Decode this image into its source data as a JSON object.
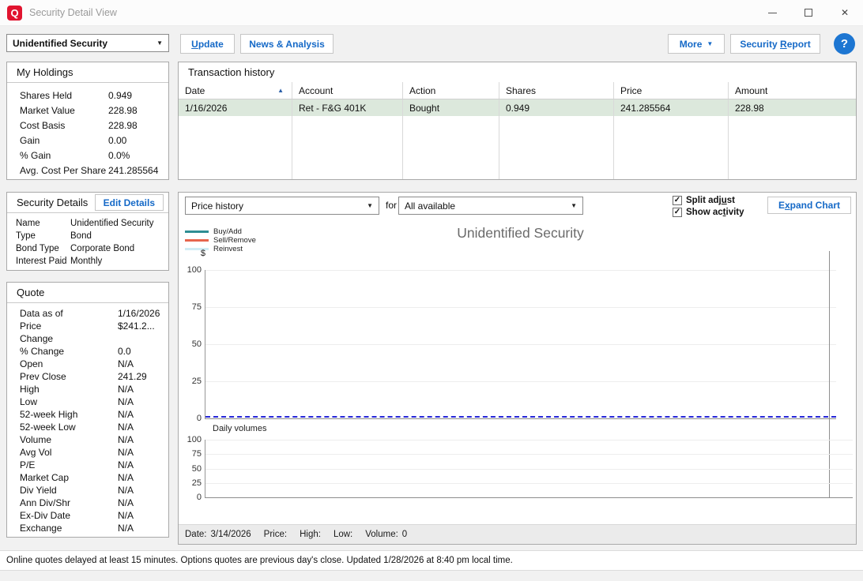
{
  "window": {
    "title": "Security Detail View"
  },
  "icons": {
    "logo": "Q",
    "close": "✕",
    "dropdown_arrow": "▼",
    "sort_asc": "▲",
    "help": "?",
    "check": "✓"
  },
  "colors": {
    "accent_blue": "#1569c7",
    "logo_red": "#e1142f",
    "help_blue": "#1d76d2",
    "selected_row_green": "#dce8dc",
    "price_line_blue": "#2626d8"
  },
  "toolbar": {
    "security_selector": "Unidentified Security",
    "update": {
      "pre": "",
      "key": "U",
      "post": "pdate"
    },
    "news": "News & Analysis",
    "more": "More",
    "report": {
      "pre": "Security ",
      "key": "R",
      "post": "eport"
    }
  },
  "holdings": {
    "title": "My Holdings",
    "rows": [
      {
        "label": "Shares Held",
        "value": "0.949"
      },
      {
        "label": "Market Value",
        "value": "228.98"
      },
      {
        "label": "Cost Basis",
        "value": "228.98"
      },
      {
        "label": "Gain",
        "value": "0.00"
      },
      {
        "label": "% Gain",
        "value": "0.0%"
      },
      {
        "label": "Avg. Cost Per Share",
        "value": "241.285564"
      }
    ]
  },
  "details": {
    "title": "Security Details",
    "edit_button": "Edit Details",
    "rows": [
      {
        "label": "Name",
        "value": "Unidentified Security"
      },
      {
        "label": "Type",
        "value": "Bond"
      },
      {
        "label": "Bond Type",
        "value": "Corporate Bond"
      },
      {
        "label": "Interest Paid",
        "value": "Monthly"
      }
    ]
  },
  "quote": {
    "title": "Quote",
    "rows": [
      {
        "label": "Data as of",
        "value": "1/16/2026"
      },
      {
        "label": "Price",
        "value": "$241.2..."
      },
      {
        "label": "Change",
        "value": ""
      },
      {
        "label": "% Change",
        "value": "0.0"
      },
      {
        "label": "Open",
        "value": "N/A"
      },
      {
        "label": "Prev Close",
        "value": "241.29"
      },
      {
        "label": "High",
        "value": "N/A"
      },
      {
        "label": "Low",
        "value": "N/A"
      },
      {
        "label": "52-week High",
        "value": "N/A"
      },
      {
        "label": "52-week Low",
        "value": "N/A"
      },
      {
        "label": "Volume",
        "value": "N/A"
      },
      {
        "label": "Avg Vol",
        "value": "N/A"
      },
      {
        "label": "P/E",
        "value": "N/A"
      },
      {
        "label": "Market Cap",
        "value": "N/A"
      },
      {
        "label": "Div Yield",
        "value": "N/A"
      },
      {
        "label": "Ann Div/Shr",
        "value": "N/A"
      },
      {
        "label": "Ex-Div Date",
        "value": "N/A"
      },
      {
        "label": "Exchange",
        "value": "N/A"
      }
    ]
  },
  "transactions": {
    "title": "Transaction history",
    "columns": [
      "Date",
      "Account",
      "Action",
      "Shares",
      "Price",
      "Amount"
    ],
    "rows": [
      [
        "1/16/2026",
        "Ret - F&G 401K",
        "Bought",
        "0.949",
        "241.285564",
        "228.98"
      ]
    ]
  },
  "chart": {
    "type_selector": "Price history",
    "for_label": "for",
    "range_selector": "All available",
    "split_adjust": {
      "pre": "Split adj",
      "key": "u",
      "post": "st"
    },
    "show_activity": {
      "pre": "Show ac",
      "key": "t",
      "post": "ivity"
    },
    "expand": {
      "pre": "E",
      "key": "x",
      "post": "pand Chart"
    },
    "legend": [
      {
        "label": "Buy/Add",
        "color": "#2e8d93"
      },
      {
        "label": "Sell/Remove",
        "color": "#e7654d"
      },
      {
        "label": "Reinvest",
        "color": "#cfecf4"
      }
    ],
    "title": "Unidentified Security",
    "axis_unit": "$",
    "price_ticks": [
      "100",
      "75",
      "50",
      "25",
      "0"
    ],
    "volume_title": "Daily volumes",
    "volume_ticks": [
      "100",
      "75",
      "50",
      "25",
      "0"
    ],
    "info": {
      "date_label": "Date:",
      "date_value": "3/14/2026",
      "price_label": "Price:",
      "high_label": "High:",
      "low_label": "Low:",
      "volume_label": "Volume:",
      "volume_value": "0"
    }
  },
  "chart_data": {
    "type": "line",
    "title": "Unidentified Security",
    "ylabel": "$",
    "ylim": [
      0,
      100
    ],
    "yticks": [
      0,
      25,
      50,
      75,
      100
    ],
    "x_range": "All available",
    "legend": [
      "Buy/Add",
      "Sell/Remove",
      "Reinvest"
    ],
    "legend_position": "top-left",
    "grid": true,
    "series": [
      {
        "name": "Price",
        "style": "dashed-blue",
        "values": "constant 0 across entire visible range"
      }
    ],
    "subchart": {
      "type": "bar",
      "title": "Daily volumes",
      "ylim": [
        0,
        100
      ],
      "yticks": [
        0,
        25,
        50,
        75,
        100
      ],
      "values": []
    },
    "crosshair": {
      "date": "3/14/2026",
      "volume": 0
    }
  },
  "status_bar": "Online quotes delayed at least 15 minutes. Options quotes are previous day's close. Updated 1/28/2026 at 8:40 pm local time."
}
